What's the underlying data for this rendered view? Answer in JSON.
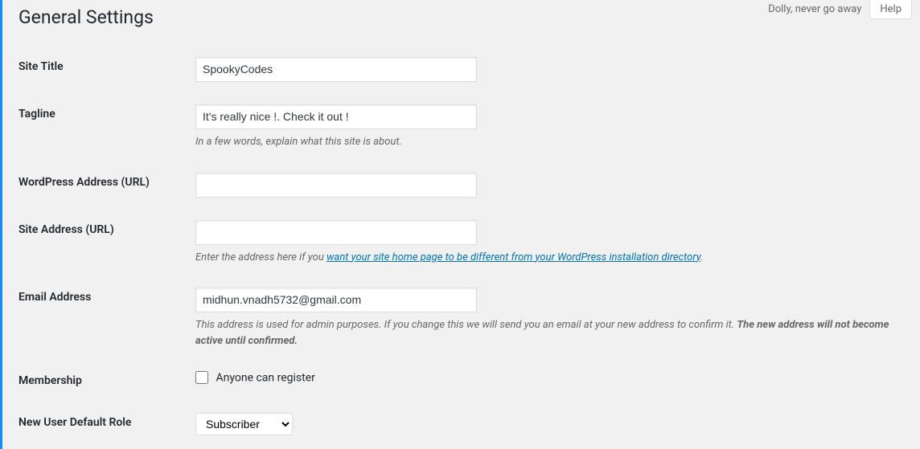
{
  "topbar": {
    "dolly_quote": "Dolly, never go away",
    "help_label": "Help"
  },
  "page": {
    "title": "General Settings"
  },
  "fields": {
    "site_title": {
      "label": "Site Title",
      "value": "SpookyCodes"
    },
    "tagline": {
      "label": "Tagline",
      "value": "It's really nice !. Check it out !",
      "description": "In a few words, explain what this site is about."
    },
    "wp_url": {
      "label": "WordPress Address (URL)",
      "value": ""
    },
    "site_url": {
      "label": "Site Address (URL)",
      "value": "",
      "desc_prefix": "Enter the address here if you ",
      "desc_link": "want your site home page to be different from your WordPress installation directory",
      "desc_suffix": "."
    },
    "email": {
      "label": "Email Address",
      "value": "midhun.vnadh5732@gmail.com",
      "desc_prefix": "This address is used for admin purposes. If you change this we will send you an email at your new address to confirm it. ",
      "desc_strong": "The new address will not become active until confirmed."
    },
    "membership": {
      "label": "Membership",
      "checkbox_label": "Anyone can register",
      "checked": false
    },
    "default_role": {
      "label": "New User Default Role",
      "selected": "Subscriber"
    }
  }
}
